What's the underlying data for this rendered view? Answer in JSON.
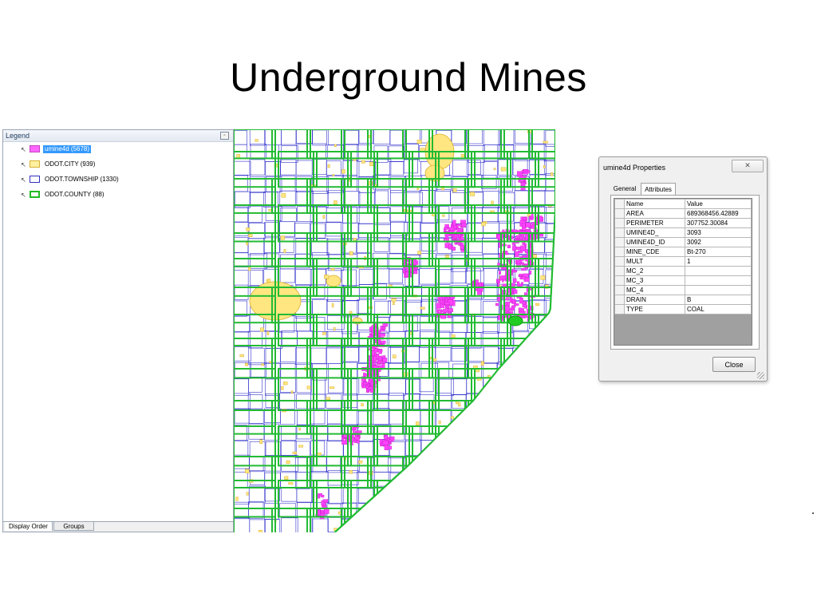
{
  "slide": {
    "title": "Underground Mines"
  },
  "legend": {
    "header": "Legend",
    "layers": [
      {
        "label": "umine4d (5678)",
        "fill": "#ff66ff",
        "stroke": "#c040c0",
        "selected": true
      },
      {
        "label": "ODOT.CITY (939)",
        "fill": "#fff0a0",
        "stroke": "#d8b030",
        "selected": false
      },
      {
        "label": "ODOT.TOWNSHIP (1330)",
        "fill": "#ffffff",
        "stroke": "#3030c0",
        "selected": false
      },
      {
        "label": "ODOT.COUNTY (88)",
        "fill": "#ffffff",
        "stroke": "#22bb22",
        "selected": false
      }
    ],
    "tabs": [
      "Display Order",
      "Groups"
    ]
  },
  "dialog": {
    "title": "umine4d Properties",
    "tabs": [
      "General",
      "Attributes"
    ],
    "active_tab": "Attributes",
    "columns": [
      "Name",
      "Value"
    ],
    "rows": [
      {
        "name": "AREA",
        "value": "689368456.42889"
      },
      {
        "name": "PERIMETER",
        "value": "307752.30084"
      },
      {
        "name": "UMINE4D_",
        "value": "3093"
      },
      {
        "name": "UMINE4D_ID",
        "value": "3092"
      },
      {
        "name": "MINE_CDE",
        "value": "Bt-270"
      },
      {
        "name": "MULT",
        "value": "1"
      },
      {
        "name": "MC_2",
        "value": ""
      },
      {
        "name": "MC_3",
        "value": ""
      },
      {
        "name": "MC_4",
        "value": ""
      },
      {
        "name": "DRAIN",
        "value": "B"
      },
      {
        "name": "TYPE",
        "value": "COAL"
      }
    ],
    "close_label": "Close"
  },
  "colors": {
    "mine": "#ff44ff",
    "city": "#ffe680",
    "township": "#3333cc",
    "county": "#22bb33",
    "selected_feature": "#22cc22"
  }
}
